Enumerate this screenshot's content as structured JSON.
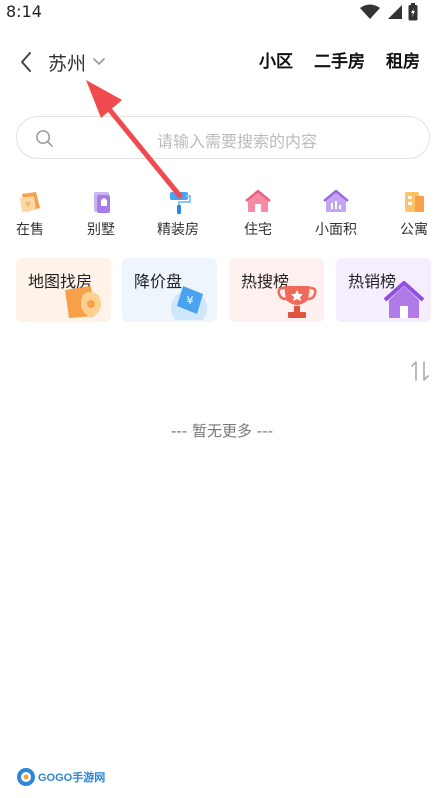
{
  "status_bar": {
    "time": "8:14",
    "icons": [
      "wifi-icon",
      "signal-icon",
      "battery-icon"
    ]
  },
  "header": {
    "back_icon": "chevron-left-icon",
    "city": "苏州",
    "city_dropdown_icon": "chevron-down-icon",
    "nav": [
      "小区",
      "二手房",
      "租房"
    ]
  },
  "search": {
    "placeholder": "请输入需要搜索的内容",
    "icon": "search-icon"
  },
  "categories": [
    {
      "label": "在售",
      "icon": "for-sale-icon"
    },
    {
      "label": "别墅",
      "icon": "villa-icon"
    },
    {
      "label": "精装房",
      "icon": "paint-roller-icon"
    },
    {
      "label": "住宅",
      "icon": "house-icon"
    },
    {
      "label": "小面积",
      "icon": "small-area-icon"
    },
    {
      "label": "公寓",
      "icon": "apartment-icon"
    }
  ],
  "feature_cards": [
    {
      "title": "地图找房",
      "icon": "map-pin-icon",
      "bg": "#fdf3e9"
    },
    {
      "title": "降价盘",
      "icon": "price-tag-icon",
      "bg": "#eef5fd"
    },
    {
      "title": "热搜榜",
      "icon": "trophy-icon",
      "bg": "#fdf0ee"
    },
    {
      "title": "热销榜",
      "icon": "hot-house-icon",
      "bg": "#f6eefd"
    }
  ],
  "sort_icon": "sort-icon",
  "list_footer": "--- 暂无更多 ---",
  "colors": {
    "arrow": "#f04a4f",
    "accent_orange": "#f7a04a",
    "accent_blue": "#4aa3f0",
    "accent_purple": "#a061e6",
    "accent_red": "#f06a5a"
  },
  "watermark": "GOGO手游网"
}
